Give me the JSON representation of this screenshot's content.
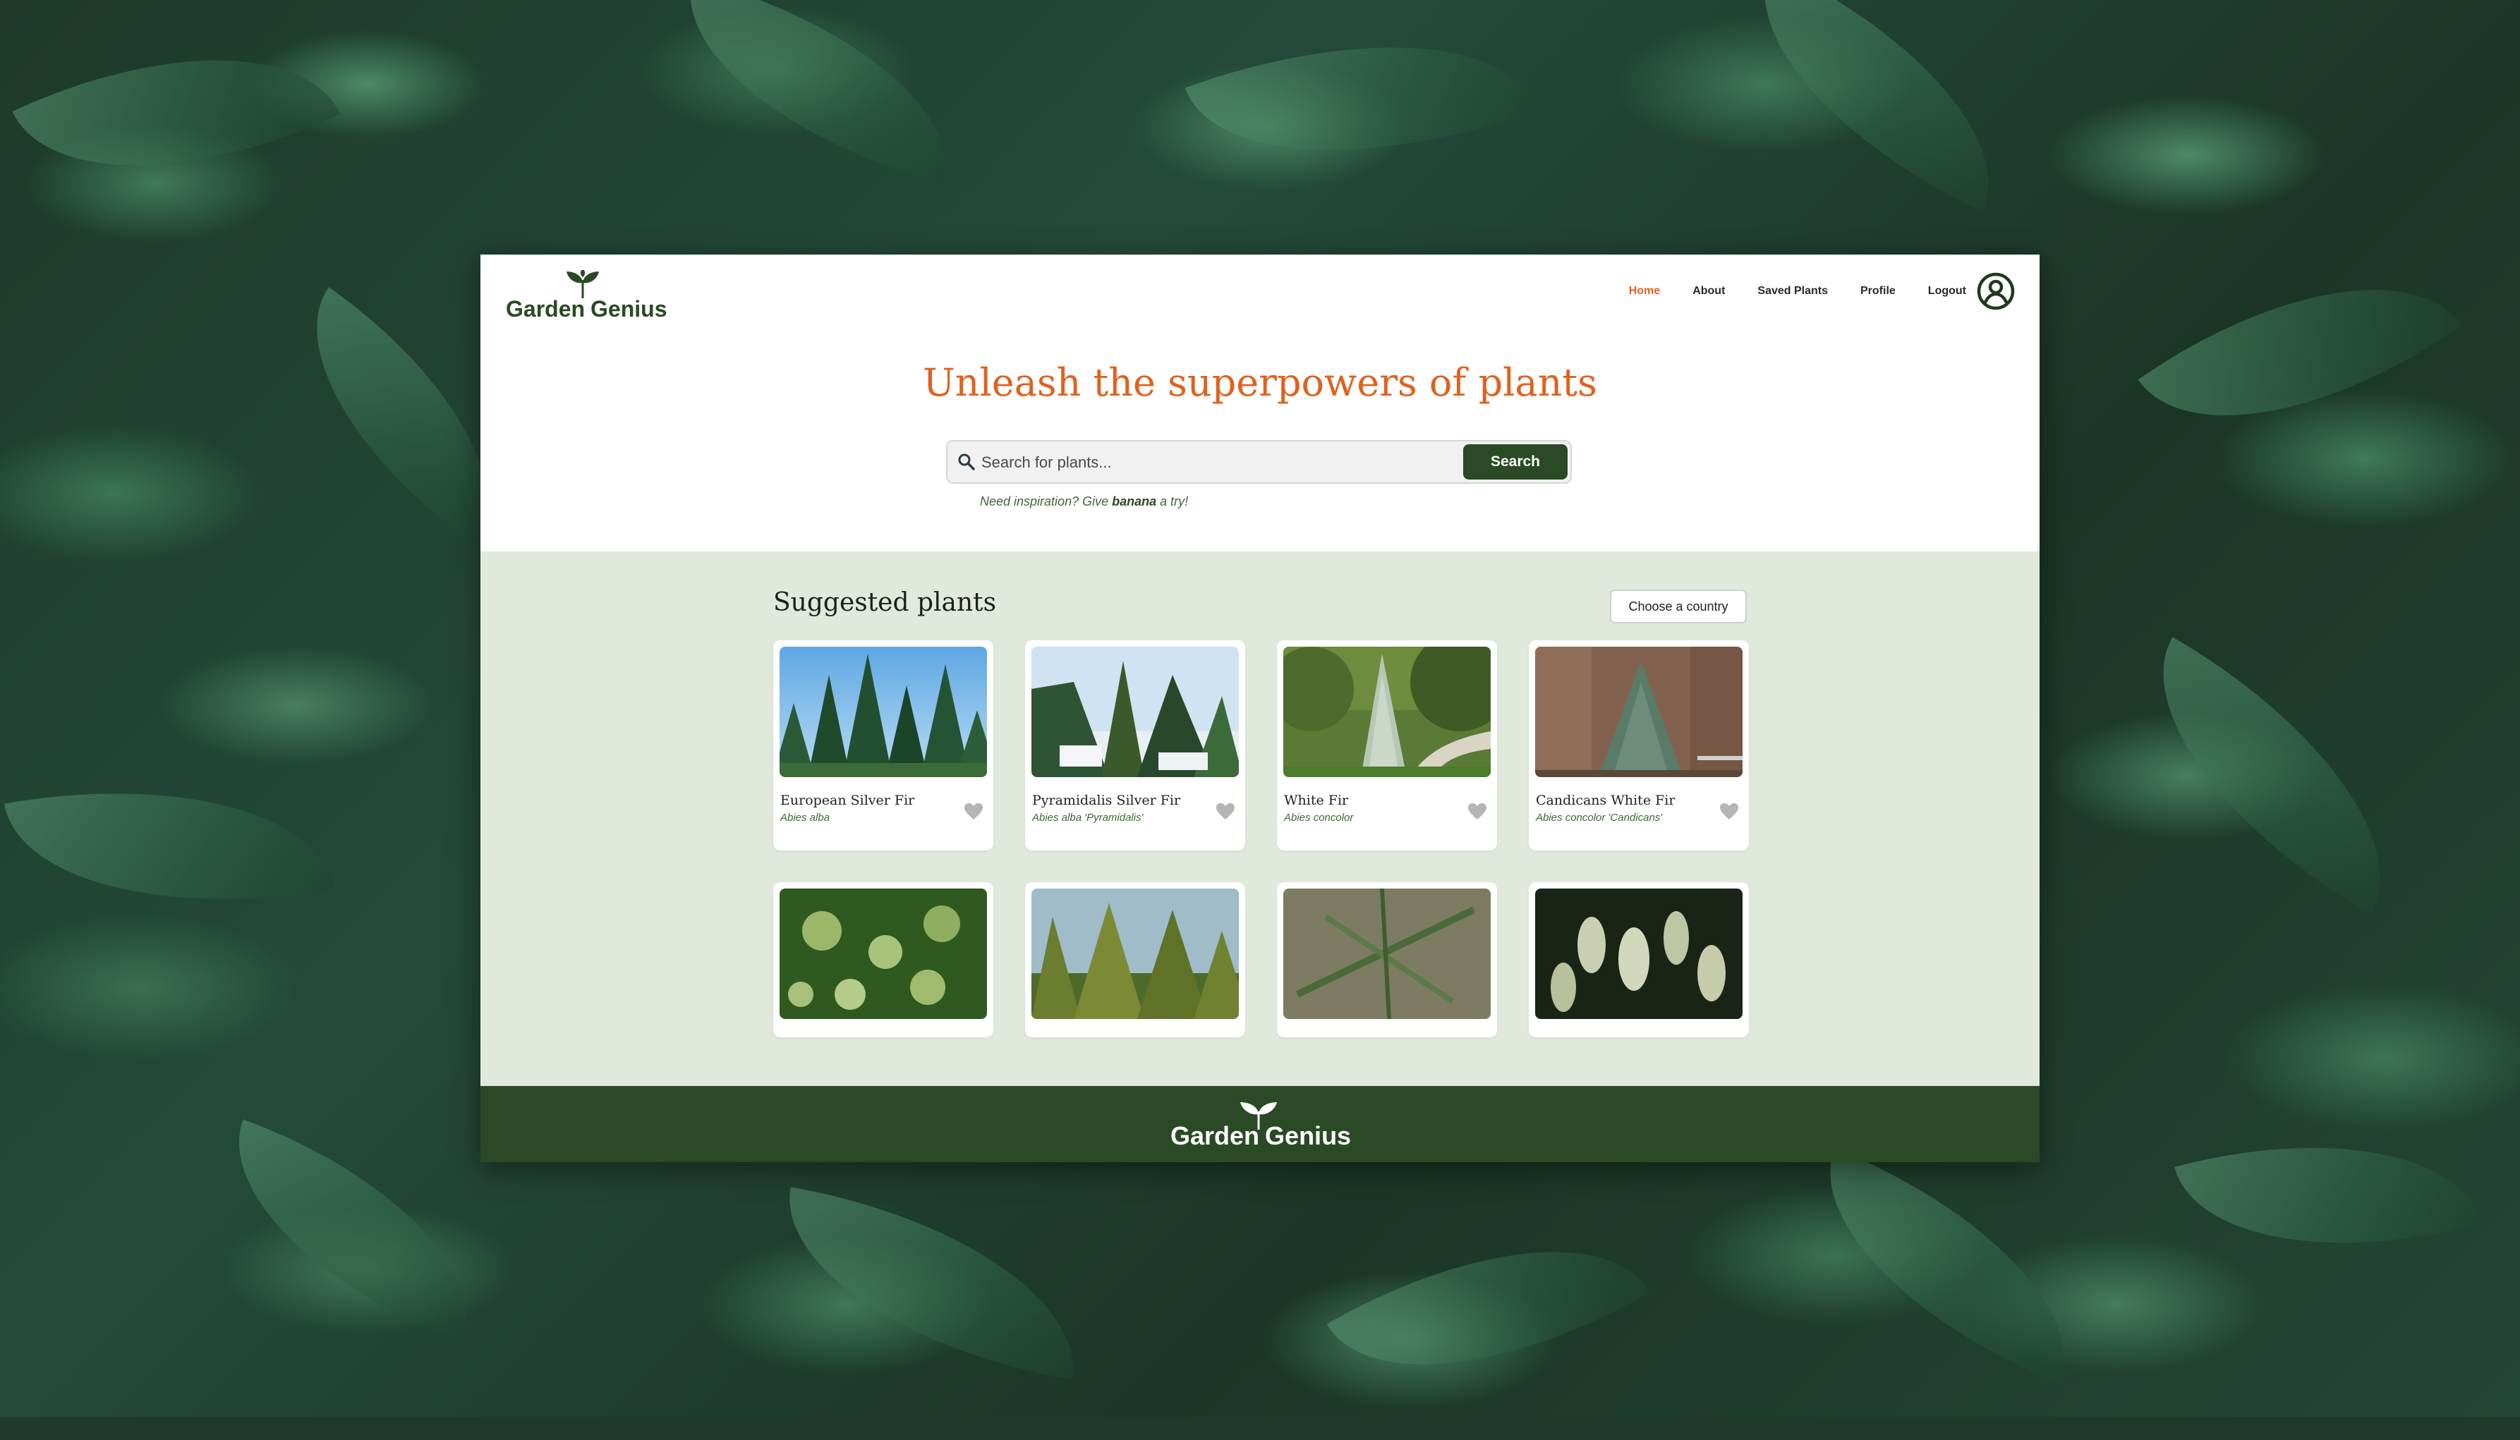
{
  "brand": {
    "word1": "Garden",
    "word2": "Genius"
  },
  "nav": {
    "items": [
      {
        "label": "Home",
        "active": true
      },
      {
        "label": "About",
        "active": false
      },
      {
        "label": "Saved Plants",
        "active": false
      },
      {
        "label": "Profile",
        "active": false
      },
      {
        "label": "Logout",
        "active": false
      }
    ]
  },
  "hero": {
    "title": "Unleash the superpowers of plants"
  },
  "search": {
    "placeholder": "Search for plants...",
    "value": "",
    "button_label": "Search",
    "hint_prefix": "Need inspiration? Give ",
    "hint_keyword": "banana",
    "hint_suffix": " a try!"
  },
  "suggested": {
    "title": "Suggested plants",
    "country_button": "Choose a country",
    "plants": [
      {
        "name": "European Silver Fir",
        "latin": "Abies alba"
      },
      {
        "name": "Pyramidalis Silver Fir",
        "latin": "Abies alba 'Pyramidalis'"
      },
      {
        "name": "White Fir",
        "latin": "Abies concolor"
      },
      {
        "name": "Candicans White Fir",
        "latin": "Abies concolor 'Candicans'"
      },
      {
        "name": "",
        "latin": ""
      },
      {
        "name": "",
        "latin": ""
      },
      {
        "name": "",
        "latin": ""
      },
      {
        "name": "",
        "latin": ""
      }
    ]
  },
  "colors": {
    "accent": "#e0621f",
    "brand_green": "#2a4a25",
    "section_bg": "#e1e8dc",
    "latin_green": "#3d6a35",
    "heart_grey": "#b5b5b5"
  },
  "icons": {
    "logo": "sprout-icon",
    "profile": "user-circle-icon",
    "search": "search-icon",
    "favorite": "heart-icon"
  }
}
